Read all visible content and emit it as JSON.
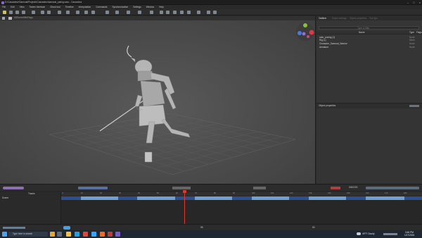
{
  "window": {
    "title": "D:\\Cascadeur\\Samurai\\Projects\\Cascadeur\\samurai_paring.casc - Cascadeur"
  },
  "menu": [
    "File",
    "Edit",
    "View",
    "Tween Interface",
    "Ghost tool",
    "Timeline",
    "Interpolation",
    "Commands",
    "Synchronization",
    "Settings",
    "Window",
    "Help"
  ],
  "viewport": {
    "scene_label": "AllSceneWithFlags"
  },
  "outliner": {
    "tabs": [
      "Outliner",
      "Scene settings",
      "Object properties",
      "Tool tips"
    ],
    "search_placeholder": "Type to filter",
    "columns": [
      "Name",
      "Type",
      "Flags"
    ],
    "rows": [
      {
        "name": "auto_posing (1)",
        "type": "Node"
      },
      {
        "name": "Rig (1)",
        "type": "Mesh"
      },
      {
        "name": "Character_Samurai_Warrior",
        "type": "Node"
      },
      {
        "name": "Armature",
        "type": "Node"
      }
    ]
  },
  "object_properties": {
    "title": "Object properties"
  },
  "timeline": {
    "tracks_label": "Tracks",
    "scene_label": "Scene",
    "frame_field": "0/40/220",
    "frame_numbers": [
      "0",
      "10",
      "20",
      "30",
      "40",
      "50",
      "60",
      "70",
      "80",
      "90",
      "100",
      "110",
      "120",
      "130",
      "140",
      "150",
      "160",
      "170",
      "180"
    ],
    "status_frame": "95",
    "status_right": "50"
  },
  "taskbar": {
    "search_placeholder": "Type here to search",
    "weather": "49°F Cloudy",
    "time": "3:46 PM",
    "date": "1/17/2024"
  },
  "colors": {
    "accent": "#6f9fd3",
    "keyframe": "#2e4f8f",
    "playhead": "#e0392b"
  }
}
